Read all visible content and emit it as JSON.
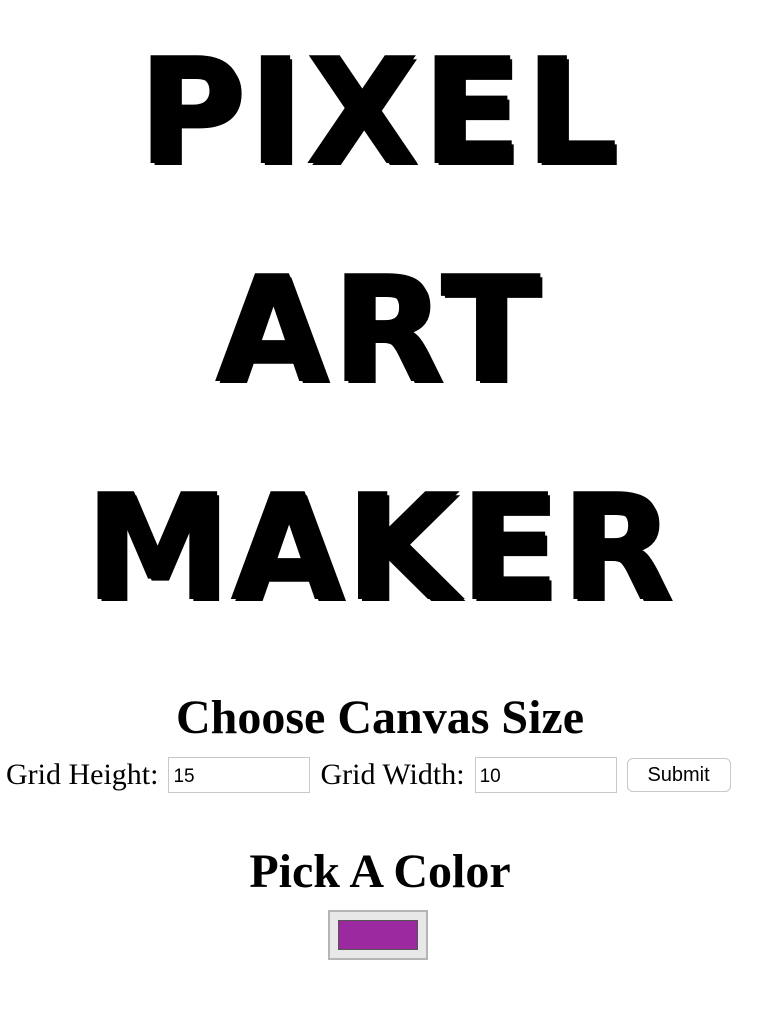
{
  "title": {
    "line1": "Pixel",
    "line2": "Art",
    "line3": "Maker"
  },
  "canvas_size": {
    "heading": "Choose Canvas Size",
    "grid_height_label": "Grid Height:",
    "grid_height_value": "15",
    "grid_width_label": "Grid Width:",
    "grid_width_value": "10",
    "submit_label": "Submit"
  },
  "color": {
    "heading": "Pick A Color",
    "selected_color": "#9b2aa0"
  }
}
